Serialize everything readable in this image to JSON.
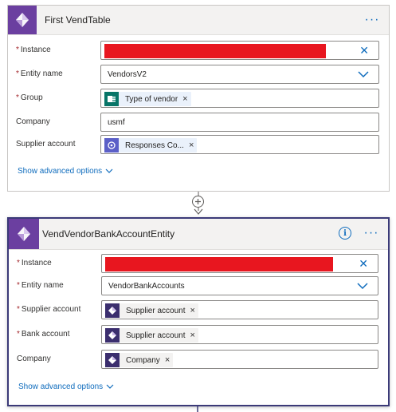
{
  "card1": {
    "title": "First VendTable",
    "more_label": "···",
    "fields": {
      "instance": {
        "label": "Instance",
        "required": "*",
        "clear": "✕"
      },
      "entity_name": {
        "label": "Entity name",
        "required": "*",
        "value": "VendorsV2"
      },
      "group": {
        "label": "Group",
        "required": "*",
        "token_text": "Type of vendor",
        "token_remove": "×",
        "token_icon": "forms-icon"
      },
      "company": {
        "label": "Company",
        "value": "usmf"
      },
      "supplier_account": {
        "label": "Supplier account",
        "token_text": "Responses Co...",
        "token_remove": "×",
        "token_icon": "teams-icon"
      }
    },
    "advanced": "Show advanced options"
  },
  "card2": {
    "title": "VendVendorBankAccountEntity",
    "info_label": "i",
    "more_label": "···",
    "fields": {
      "instance": {
        "label": "Instance",
        "required": "*",
        "clear": "✕"
      },
      "entity_name": {
        "label": "Entity name",
        "required": "*",
        "value": "VendorBankAccounts"
      },
      "supplier_account": {
        "label": "Supplier account",
        "required": "*",
        "token_text": "Supplier account",
        "token_remove": "×",
        "token_icon": "dynamics-icon"
      },
      "bank_account": {
        "label": "Bank account",
        "required": "*",
        "token_text": "Supplier account",
        "token_remove": "×",
        "token_icon": "dynamics-icon"
      },
      "company": {
        "label": "Company",
        "token_text": "Company",
        "token_remove": "×",
        "token_icon": "dynamics-icon"
      }
    },
    "advanced": "Show advanced options"
  },
  "colors": {
    "accent": "#0f6cbd",
    "brand_purple": "#6b3fa0",
    "required": "#a4262c",
    "redaction": "#e8161f",
    "forms_green": "#077568",
    "teams_indigo": "#5b5fc7"
  }
}
